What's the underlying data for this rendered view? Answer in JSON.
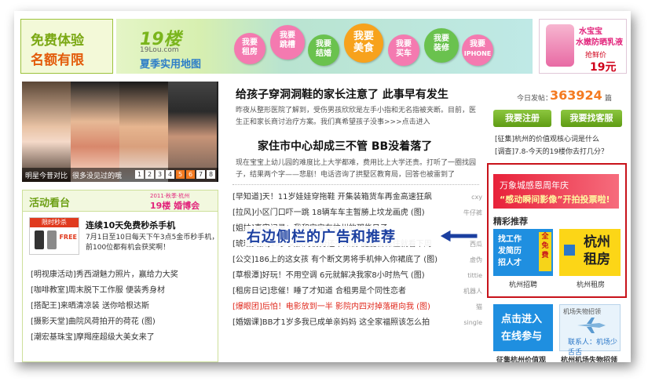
{
  "ads": {
    "free_trial": {
      "line1": "免费体验",
      "line2": "名额有限"
    },
    "site": {
      "logo": "19楼",
      "domain": "19Lou.com",
      "slogan": "夏季实用地图"
    },
    "bubbles": [
      {
        "l1": "我要",
        "l2": "租房",
        "color": "#f47ab0"
      },
      {
        "l1": "我要",
        "l2": "跳槽",
        "color": "#f47ab0"
      },
      {
        "l1": "我要",
        "l2": "结婚",
        "color": "#6ac24e"
      },
      {
        "l1": "我要",
        "l2": "美食",
        "color": "#f7a21c"
      },
      {
        "l1": "我要",
        "l2": "买车",
        "color": "#f47ab0"
      },
      {
        "l1": "我要",
        "l2": "装修",
        "color": "#6ac24e"
      },
      {
        "l1": "我要",
        "l2": "IPHONE",
        "color": "#f47ab0"
      }
    ],
    "cosmetic": {
      "brand": "水宝宝",
      "product": "水嫩防晒乳液",
      "promo": "抢鲜价",
      "price": "19元"
    }
  },
  "slideshow": {
    "caption_left": "明星今昔对比",
    "caption_right": "很多没见过的哦",
    "pages": [
      "1",
      "2",
      "3",
      "4",
      "5",
      "6",
      "7",
      "8"
    ],
    "active_pages": [
      "5",
      "6"
    ]
  },
  "activity": {
    "title": "活动看台",
    "badge": "19楼 婚博会",
    "badge_sub": "2011·秋季·杭州",
    "product_tag": "限时秒杀",
    "product_free": "FREE",
    "promo_title": "连续10天免费秒杀手机",
    "promo_desc": "7月1日至10日每天下午3点5金币秒手机，前100位都有机会获奖啊！",
    "items": [
      "[明视康活动]秀西湖魅力照片，赢给力大奖",
      "[咖啡教室]周末脱下工作服 便装秀身材",
      "[搭配王]来晒清凉装 送你哈根达斯",
      "[摄影天堂]曲院风荷拍开的荷花 (图)",
      "[潮宏基珠宝]摩羯座超级大美女来了"
    ]
  },
  "headlines": {
    "top1": "给孩子穿洞洞鞋的家长注意了 此事早有发生",
    "top1_desc": "昨夜从整形医院了解到，受伤男孩欣欣是左手小指和无名指被夹断。目前，医生正和家长商讨治疗方案。我们真希望孩子没事>>>点击进入",
    "top2": "家住市中心却成三不管 BB没着落了",
    "top2_desc": "现在宝宝上幼儿园的难度比上大学都难，费用比上大学还贵。打听了一圈找园子，结果两个字——悲剧！电话咨询了拱墅区教育局，回答也被雷到了"
  },
  "news": [
    {
      "text": "[早知道]天！11岁娃娃穿拖鞋 开集装箱货车再金高速狂飙",
      "author": "cxy",
      "red": false
    },
    {
      "text": "[拉风]小区门口吓一跳 18辆车车主暂勝上坟龙画虎 (图)",
      "author": "牛仔裤",
      "red": false
    },
    {
      "text": "[姐妹]真实记录：我和宝宝在杭州的那些日子",
      "author": "",
      "red": false
    },
    {
      "text": "[琥珀女孩]19岁女孩对伤势还不知情 腿能否保住就看下周",
      "author": "西瓜",
      "red": false
    },
    {
      "text": "[公交]186上的这女孩 有个断文男将手机伸入你裙底了 (图)",
      "author": "虚伪",
      "red": false
    },
    {
      "text": "[草根潭]好玩！不用空调 6元就解决我家8小时热气 (图)",
      "author": "tittie",
      "red": false
    },
    {
      "text": "[租房日记]悲催！睡了才知道 合租男是个同性恋者",
      "author": "机器人",
      "red": false
    },
    {
      "text": "[爆眼团]后怕！电影放到一半 影院内四对掉落砸向我 (图)",
      "author": "猫",
      "red": true
    },
    {
      "text": "[婚姻课]BB才1岁多我已成单亲妈妈 这全家福照该怎么拍",
      "author": "single",
      "red": false
    }
  ],
  "annotation": {
    "text": "右边侧栏的广告和推荐",
    "arrow_color": "#1b3fa0"
  },
  "sidebar": {
    "today_label": "今日发帖：",
    "today_count": "363924",
    "unit": "篇",
    "register_button": "我要注册",
    "service_button": "我要找客服",
    "links": [
      "[征集]杭州的价值观核心词是什么",
      "[调查]7.8-今天的19楼你去打几分？"
    ],
    "banner_line1": "万象城感恩周年庆",
    "banner_line2": "“感动瞬间影像”开拍投票啦!",
    "recommend_title": "精彩推荐",
    "tile1_lines": [
      "找工作",
      "发简历",
      "招人才"
    ],
    "tile1_free": "全免费",
    "tile2_title": "杭州租房",
    "tile1_caption": "杭州招聘",
    "tile2_caption": "杭州租房",
    "tile3_lines": [
      "点击进入",
      "在线参与"
    ],
    "tile4_title": "机场失物招领",
    "tile4_sub": "联系人：机场少舌舌",
    "bottom_caption1": "征集杭州价值观",
    "bottom_caption2": "杭州机场失物招领"
  }
}
